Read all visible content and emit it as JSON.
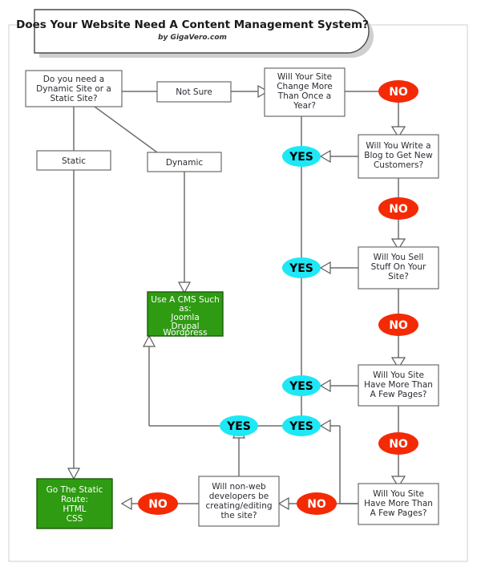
{
  "banner": {
    "title": "Does Your Website Need A Content Management System?",
    "subtitle": "by GigaVero.com"
  },
  "nodes": {
    "start": {
      "lines": [
        "Do you need a",
        "Dynamic Site or a",
        "Static Site?"
      ]
    },
    "not_sure": {
      "lines": [
        "Not Sure"
      ]
    },
    "static": {
      "lines": [
        "Static"
      ]
    },
    "dynamic": {
      "lines": [
        "Dynamic"
      ]
    },
    "q_change": {
      "lines": [
        "Will Your Site",
        "Change More",
        "Than Once a",
        "Year?"
      ]
    },
    "q_blog": {
      "lines": [
        "Will You Write a",
        "Blog to Get New",
        "Customers?"
      ]
    },
    "q_sell": {
      "lines": [
        "Will You Sell",
        "Stuff On Your",
        "Site?"
      ]
    },
    "q_pages_1": {
      "lines": [
        "Will You Site",
        "Have More Than",
        "A Few Pages?"
      ]
    },
    "q_pages_2": {
      "lines": [
        "Will You Site",
        "Have More Than",
        "A Few Pages?"
      ]
    },
    "q_nonweb": {
      "lines": [
        "Will non-web",
        "developers be",
        "creating/editing",
        "the site?"
      ]
    },
    "cms": {
      "lines": [
        "Use A CMS Such",
        "as:",
        "Joomla",
        "Drupal",
        "Wordpress"
      ]
    },
    "static_route": {
      "lines": [
        "Go The Static",
        "Route:",
        "HTML",
        "CSS"
      ]
    }
  },
  "badges": {
    "no_change": "NO",
    "no_blog": "NO",
    "no_sell": "NO",
    "no_pages1": "NO",
    "no_pages2": "NO",
    "yes_change": "YES",
    "yes_blog": "YES",
    "yes_sell": "YES",
    "yes_pages1": "YES",
    "yes_pages2": "YES",
    "yes_nonweb": "YES"
  },
  "colors": {
    "no_badge": "#f42a05",
    "yes_badge": "#1ee8f5",
    "green_box": "#2e9b12",
    "box_border": "#6b6b6b",
    "connector": "#6e6e6e",
    "frame": "#cfcfcf"
  }
}
